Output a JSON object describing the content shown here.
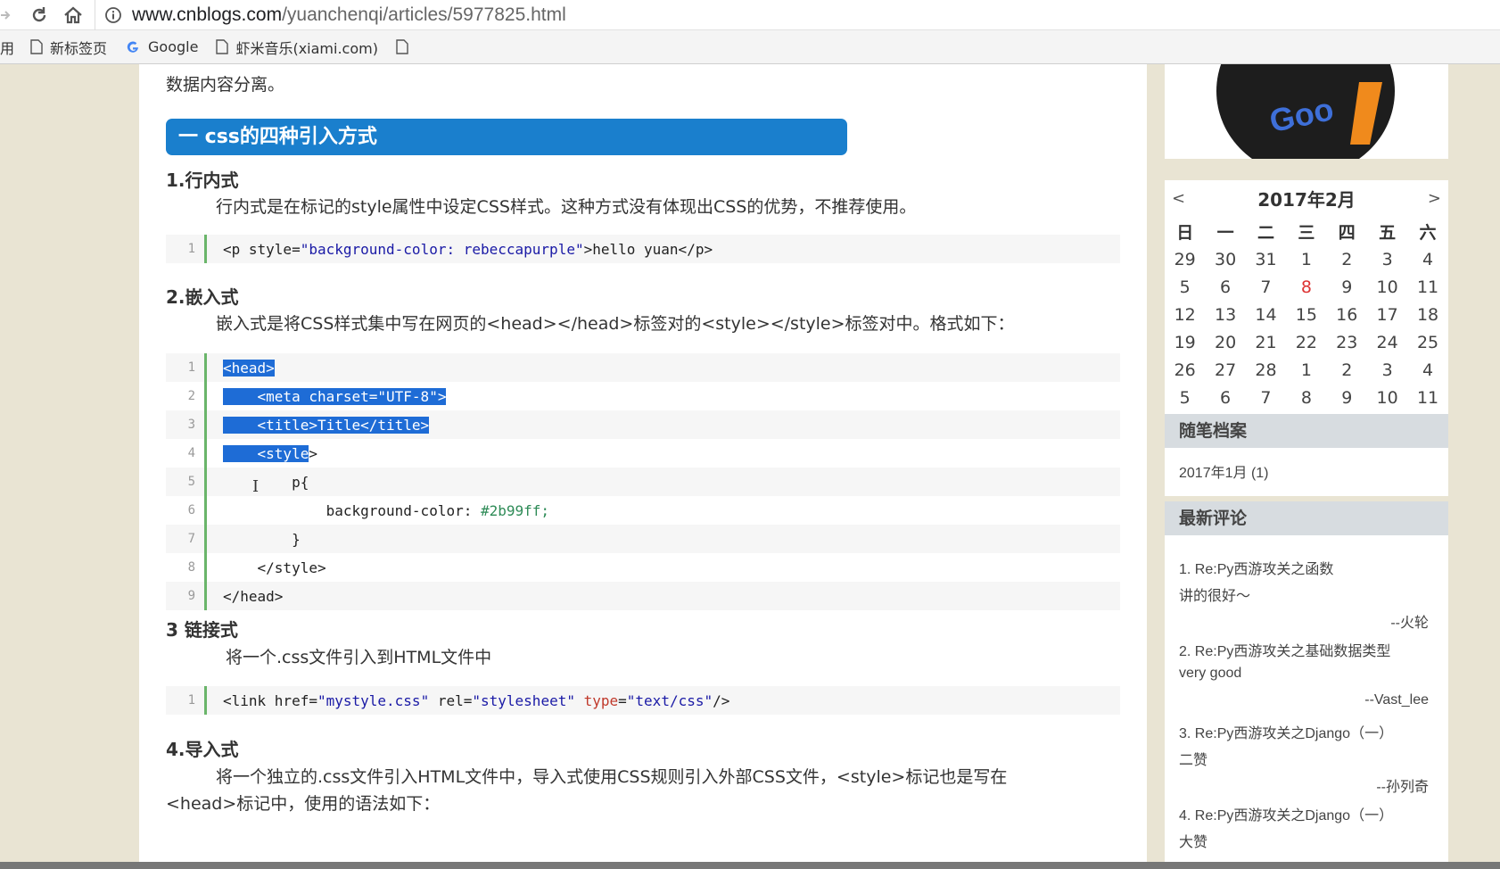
{
  "browser": {
    "url_host": "www.cnblogs.com",
    "url_path": "/yuanchenqi/articles/5977825.html",
    "bookmarks": [
      {
        "label": "用"
      },
      {
        "label": "新标签页"
      },
      {
        "label": "Google"
      },
      {
        "label": "虾米音乐(xiami.com)"
      }
    ]
  },
  "article": {
    "intro_tail": "数据内容分离。",
    "section_title": "一 css的四种引入方式",
    "s1": {
      "title": "1.行内式",
      "desc": "行内式是在标记的style属性中设定CSS样式。这种方式没有体现出CSS的优势，不推荐使用。",
      "code": [
        {
          "n": "1",
          "parts": [
            [
              "<p style=",
              ""
            ],
            [
              "\"background-color: rebeccapurple\"",
              "k-str"
            ],
            [
              ">hello yuan</p>",
              ""
            ]
          ]
        }
      ]
    },
    "s2": {
      "title": "2.嵌入式",
      "desc": "嵌入式是将CSS样式集中写在网页的<head></head>标签对的<style></style>标签对中。格式如下：",
      "code": [
        {
          "n": "1",
          "text": "<head>",
          "sel": "<head>"
        },
        {
          "n": "2",
          "text": "    <meta charset=\"UTF-8\">",
          "sel": "    <meta charset=\"UTF-8\">"
        },
        {
          "n": "3",
          "text": "    <title>Title</title>",
          "sel": "    <title>Title</title>"
        },
        {
          "n": "4",
          "text": "    <style>",
          "sel": "    <style"
        },
        {
          "n": "5",
          "text": "        p{"
        },
        {
          "n": "6",
          "text": "            background-color: #2b99ff;",
          "val": "#2b99ff;"
        },
        {
          "n": "7",
          "text": "        }"
        },
        {
          "n": "8",
          "text": "    </style>"
        },
        {
          "n": "9",
          "text": "</head>"
        }
      ]
    },
    "s3": {
      "title": "3 链接式",
      "desc": "将一个.css文件引入到HTML文件中",
      "code": [
        {
          "n": "1",
          "parts": [
            [
              "<link href=",
              ""
            ],
            [
              "\"mystyle.css\"",
              "k-str"
            ],
            [
              " rel=",
              ""
            ],
            [
              "\"stylesheet\"",
              "k-str"
            ],
            [
              " ",
              ""
            ],
            [
              "type",
              "k-attr"
            ],
            [
              "=",
              ""
            ],
            [
              "\"text/css\"",
              "k-str"
            ],
            [
              "/>",
              ""
            ]
          ]
        }
      ]
    },
    "s4": {
      "title": "4.导入式",
      "desc": "将一个独立的.css文件引入HTML文件中，导入式使用CSS规则引入外部CSS文件，<style>标记也是写在",
      "desc2": "<head>标记中，使用的语法如下："
    }
  },
  "sidebar": {
    "calendar": {
      "title": "2017年2月",
      "prev": "<",
      "next": ">",
      "weekdays": [
        "日",
        "一",
        "二",
        "三",
        "四",
        "五",
        "六"
      ],
      "weeks": [
        [
          "29",
          "30",
          "31",
          "1",
          "2",
          "3",
          "4"
        ],
        [
          "5",
          "6",
          "7",
          "8",
          "9",
          "10",
          "11"
        ],
        [
          "12",
          "13",
          "14",
          "15",
          "16",
          "17",
          "18"
        ],
        [
          "19",
          "20",
          "21",
          "22",
          "23",
          "24",
          "25"
        ],
        [
          "26",
          "27",
          "28",
          "1",
          "2",
          "3",
          "4"
        ],
        [
          "5",
          "6",
          "7",
          "8",
          "9",
          "10",
          "11"
        ]
      ],
      "today": "8"
    },
    "archive": {
      "title": "随笔档案",
      "items": [
        "2017年1月 (1)"
      ]
    },
    "comments": {
      "title": "最新评论",
      "items": [
        {
          "title": "1. Re:Py西游攻关之函数",
          "body": "讲的很好～",
          "author": "--火轮"
        },
        {
          "title": "2. Re:Py西游攻关之基础数据类型",
          "body": "very good",
          "author": "--Vast_lee"
        },
        {
          "title": "3. Re:Py西游攻关之Django（一）",
          "body": "二赞",
          "author": "--孙列奇"
        },
        {
          "title": "4. Re:Py西游攻关之Django（一）",
          "body": "大赞",
          "author": ""
        }
      ]
    }
  },
  "colors": {
    "section_bar": "#1a7fcd",
    "selection": "#1e6cd6",
    "page_bg": "#e9e4d3"
  }
}
